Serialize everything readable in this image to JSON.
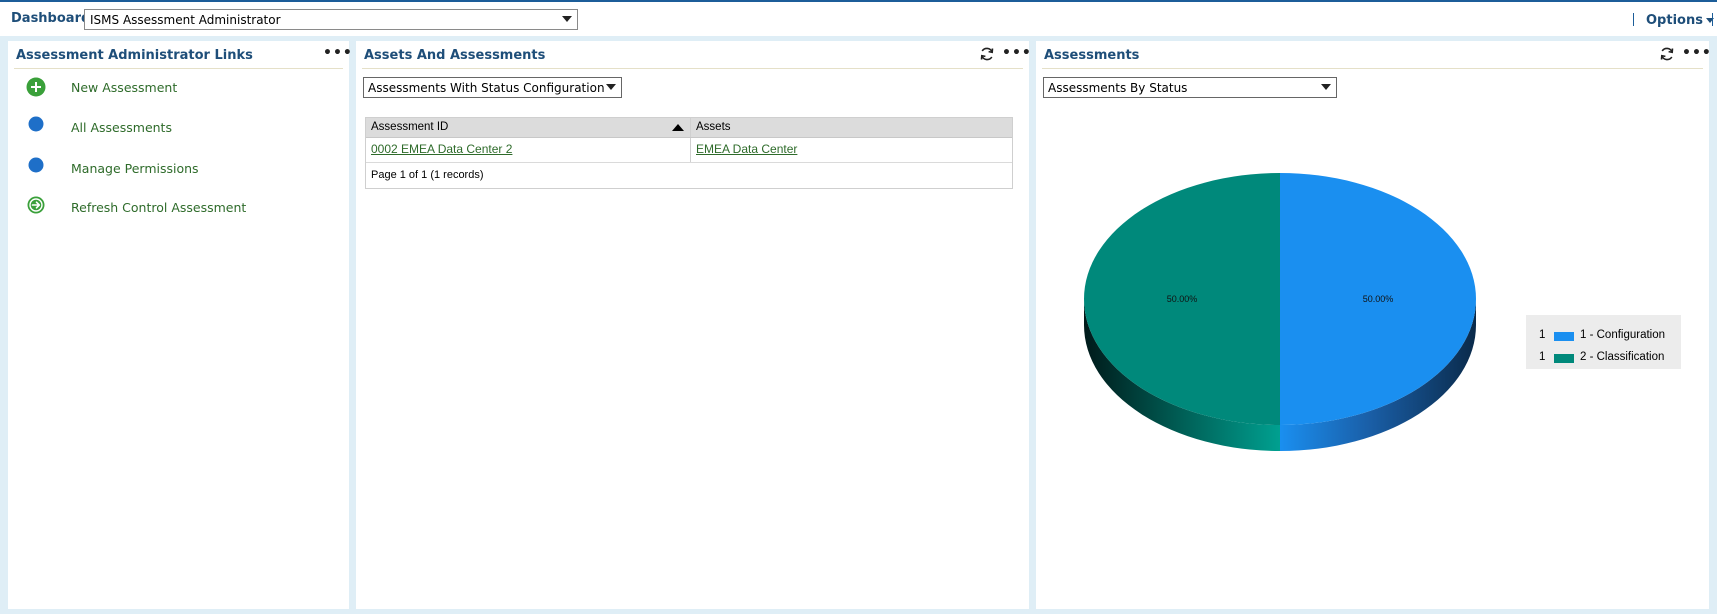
{
  "header": {
    "dashboard_label": "Dashboard:",
    "dashboard_value": "ISMS Assessment Administrator",
    "options_label": "Options"
  },
  "links_panel": {
    "title": "Assessment Administrator Links",
    "items": [
      {
        "label": "New Assessment",
        "icon": "plus-circle-icon"
      },
      {
        "label": "All Assessments",
        "icon": "blue-dot-icon"
      },
      {
        "label": "Manage Permissions",
        "icon": "blue-dot-icon"
      },
      {
        "label": "Refresh Control Assessment",
        "icon": "arrow-right-circle-icon"
      }
    ]
  },
  "assets_panel": {
    "title": "Assets And Assessments",
    "view_select": "Assessments With Status Configuration",
    "columns": [
      "Assessment ID",
      "Assets"
    ],
    "rows": [
      [
        "0002 EMEA Data Center 2",
        "EMEA Data Center"
      ]
    ],
    "pager": "Page 1 of 1 (1 records)"
  },
  "assessments_panel": {
    "title": "Assessments",
    "view_select": "Assessments By Status"
  },
  "chart_data": {
    "type": "pie",
    "style": "3d",
    "slices": [
      {
        "label": "1 - Configuration",
        "count": 1,
        "percent": 50.0,
        "percent_label": "50.00%",
        "color": "#1a8ff0"
      },
      {
        "label": "2 - Classification",
        "count": 1,
        "percent": 50.0,
        "percent_label": "50.00%",
        "color": "#00897b"
      }
    ],
    "legend_position": "right"
  },
  "colors": {
    "accent": "#1e4e79",
    "link_green": "#2e6b2a",
    "icon_green": "#3aa03a",
    "icon_blue": "#1e6fc8"
  }
}
